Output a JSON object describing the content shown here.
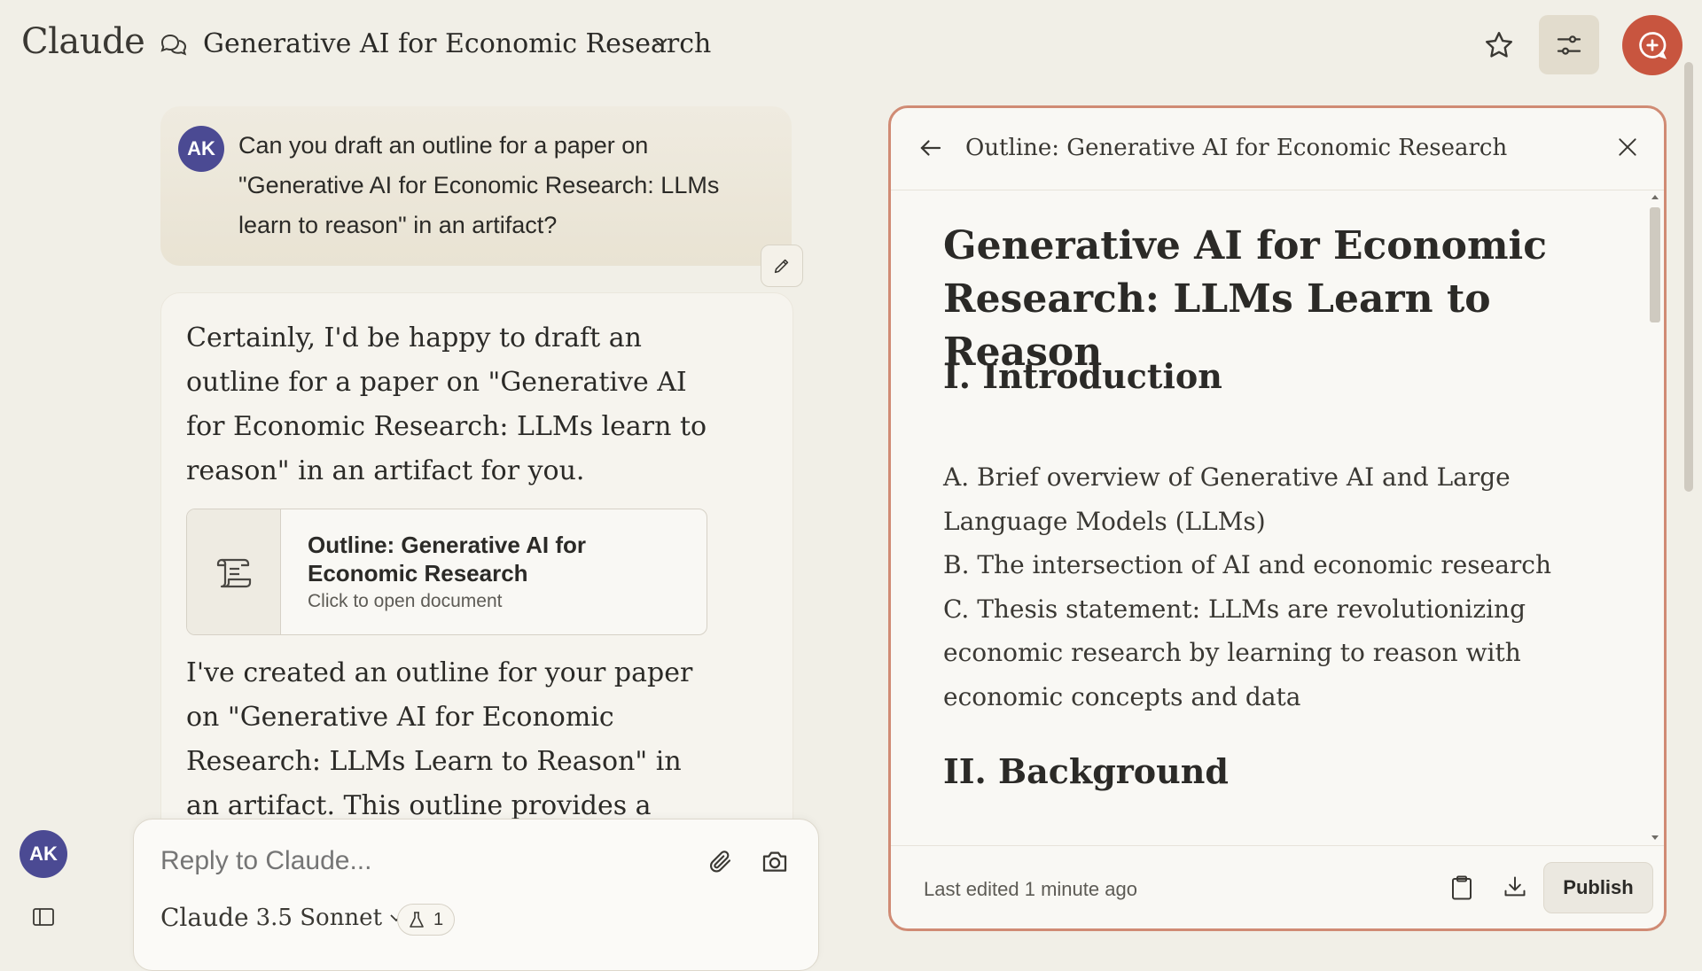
{
  "app": {
    "logo": "Claude"
  },
  "header": {
    "chat_title": "Generative AI for Economic Research"
  },
  "user": {
    "initials": "AK"
  },
  "user_message": {
    "text": "Can you draft an outline for a paper on \"Generative AI for Economic Research: LLMs learn to reason\" in an artifact?"
  },
  "assistant_message": {
    "intro": "Certainly, I'd be happy to draft an outline for a paper on \"Generative AI for Economic Research: LLMs learn to reason\" in an artifact for you.",
    "artifact_card": {
      "title": "Outline: Generative AI for Economic Research",
      "subtitle": "Click to open document"
    },
    "followup": "I've created an outline for your paper on \"Generative AI for Economic Research: LLMs Learn to Reason\" in an artifact. This outline provides a comprehensive"
  },
  "reply": {
    "placeholder": "Reply to Claude...",
    "model_name": "Claude",
    "model_version": "3.5 Sonnet",
    "badge_count": "1"
  },
  "artifact_panel": {
    "title": "Outline: Generative AI for Economic Research",
    "doc_title": "Generative AI for Economic Research: LLMs Learn to Reason",
    "section1": "I. Introduction",
    "items": [
      "A. Brief overview of Generative AI and Large Language Models (LLMs)",
      "B. The intersection of AI and economic research",
      "C. Thesis statement: LLMs are revolutionizing economic research by learning to reason with economic concepts and data"
    ],
    "section2": "II. Background",
    "last_edited": "Last edited 1 minute ago",
    "publish_label": "Publish"
  },
  "colors": {
    "accent": "#c8553f",
    "avatar": "#4b4a93",
    "panel_border": "#d08b74",
    "background": "#f1efe7"
  },
  "icons": [
    "chat-bubbles-icon",
    "chevron-down-icon",
    "star-icon",
    "sliders-icon",
    "new-chat-icon",
    "pencil-icon",
    "scroll-document-icon",
    "paperclip-icon",
    "camera-icon",
    "beaker-icon",
    "sidebar-toggle-icon",
    "arrow-left-icon",
    "close-icon",
    "clipboard-icon",
    "download-icon"
  ]
}
